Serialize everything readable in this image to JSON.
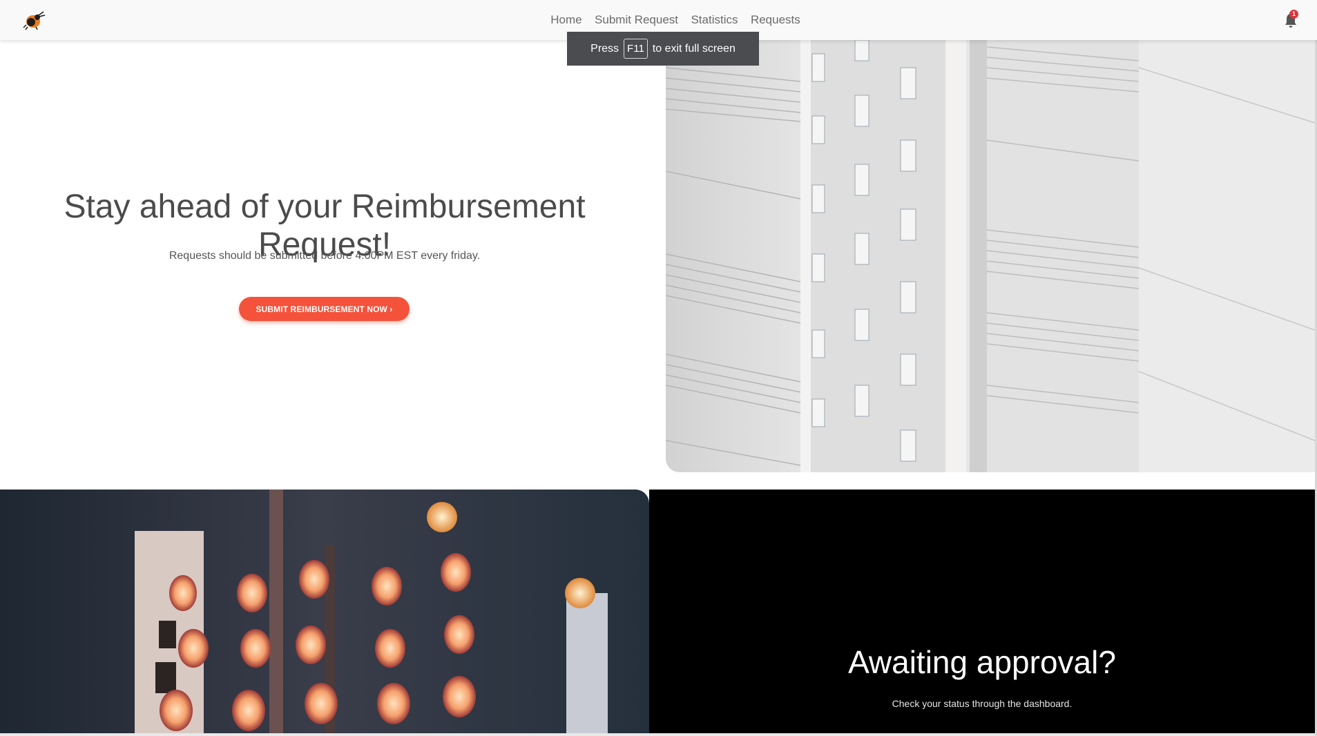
{
  "nav": {
    "logo": "logo-bug-icon",
    "links": [
      "Home",
      "Submit Request",
      "Statistics",
      "Requests"
    ],
    "notification_count": "1"
  },
  "fullscreen_toast": {
    "before": "Press",
    "key": "F11",
    "after": "to exit full screen"
  },
  "hero": {
    "title": "Stay ahead of your Reimbursement Request!",
    "subtitle": "Requests should be submitted before 4:00PM EST every friday.",
    "cta_label": "Submit Reimbursement Now ›"
  },
  "approval": {
    "title": "Awaiting approval?",
    "subtitle": "Check your status through the dashboard."
  },
  "colors": {
    "accent": "#f4523b",
    "navbar": "#f9f9f9",
    "dark": "#000000"
  }
}
